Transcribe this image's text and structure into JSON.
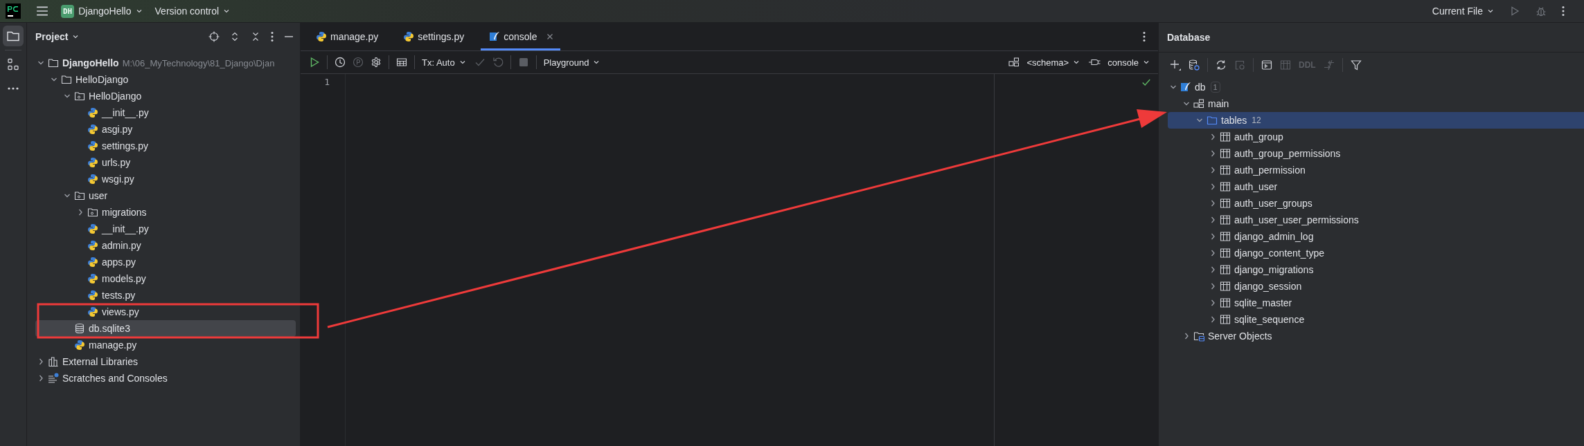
{
  "title_bar": {
    "project_badge": "DH",
    "project": "DjangoHello",
    "vcs": "Version control",
    "run_config": "Current File"
  },
  "tool_strip": [
    {
      "kind": "project",
      "selected": true
    },
    {
      "kind": "structure",
      "selected": false
    },
    {
      "kind": "more",
      "selected": false
    }
  ],
  "project_panel": {
    "title": "Project",
    "tree": [
      {
        "name": "DjangoHello",
        "path": "M:\\06_MyTechnology\\81_Django\\Djan",
        "kind": "folder",
        "expanded": true,
        "selected": false,
        "children": [
          {
            "name": "HelloDjango",
            "kind": "folder",
            "expanded": true,
            "selected": false,
            "children": [
              {
                "name": "HelloDjango",
                "kind": "package",
                "expanded": true,
                "selected": false,
                "children": [
                  {
                    "name": "__init__.py",
                    "kind": "python",
                    "selected": false
                  },
                  {
                    "name": "asgi.py",
                    "kind": "python",
                    "selected": false
                  },
                  {
                    "name": "settings.py",
                    "kind": "python",
                    "selected": false
                  },
                  {
                    "name": "urls.py",
                    "kind": "python",
                    "selected": false
                  },
                  {
                    "name": "wsgi.py",
                    "kind": "python",
                    "selected": false
                  }
                ]
              },
              {
                "name": "user",
                "kind": "package",
                "expanded": true,
                "selected": false,
                "children": [
                  {
                    "name": "migrations",
                    "kind": "package",
                    "expanded": false,
                    "selected": false
                  },
                  {
                    "name": "__init__.py",
                    "kind": "python",
                    "selected": false
                  },
                  {
                    "name": "admin.py",
                    "kind": "python",
                    "selected": false
                  },
                  {
                    "name": "apps.py",
                    "kind": "python",
                    "selected": false
                  },
                  {
                    "name": "models.py",
                    "kind": "python",
                    "selected": false
                  },
                  {
                    "name": "tests.py",
                    "kind": "python",
                    "selected": false
                  },
                  {
                    "name": "views.py",
                    "kind": "python",
                    "selected": false
                  }
                ]
              },
              {
                "name": "db.sqlite3",
                "kind": "sqlite",
                "selected": true
              },
              {
                "name": "manage.py",
                "kind": "python",
                "selected": false
              }
            ]
          }
        ]
      },
      {
        "name": "External Libraries",
        "kind": "library",
        "expanded": false,
        "selected": false
      },
      {
        "name": "Scratches and Consoles",
        "kind": "scratches",
        "expanded": false,
        "selected": false
      }
    ]
  },
  "editor": {
    "tabs": [
      {
        "label": "manage.py",
        "kind": "python",
        "selected": false
      },
      {
        "label": "settings.py",
        "kind": "python",
        "selected": false
      },
      {
        "label": "console",
        "kind": "console",
        "selected": true
      }
    ],
    "toolbar": [
      {
        "kind": "run",
        "disabled": false
      },
      {
        "kind": "separator"
      },
      {
        "kind": "history",
        "disabled": false
      },
      {
        "kind": "pin",
        "disabled": true
      },
      {
        "kind": "settings",
        "disabled": false
      },
      {
        "kind": "separator"
      },
      {
        "kind": "grid",
        "disabled": false
      },
      {
        "kind": "separator"
      },
      {
        "kind": "dropdown",
        "label": "Tx: Auto",
        "disabled": false
      },
      {
        "kind": "commit",
        "disabled": true
      },
      {
        "kind": "rollback",
        "disabled": true
      },
      {
        "kind": "separator"
      },
      {
        "kind": "stop",
        "disabled": true
      },
      {
        "kind": "separator"
      },
      {
        "kind": "dropdown",
        "label": "Playground",
        "disabled": false
      }
    ],
    "schema": "<schema>",
    "session": "console",
    "line_numbers": [
      "1"
    ]
  },
  "database_panel": {
    "title": "Database",
    "toolbar": [
      {
        "kind": "add",
        "disabled": false
      },
      {
        "kind": "datasource",
        "disabled": false
      },
      {
        "kind": "separator"
      },
      {
        "kind": "refresh",
        "disabled": false
      },
      {
        "kind": "jump",
        "disabled": true
      },
      {
        "kind": "separator"
      },
      {
        "kind": "console",
        "disabled": false
      },
      {
        "kind": "grid",
        "disabled": true
      },
      {
        "kind": "text",
        "label": "DDL",
        "disabled": true
      },
      {
        "kind": "compare",
        "disabled": true
      },
      {
        "kind": "separator"
      },
      {
        "kind": "filter",
        "disabled": false
      }
    ],
    "tree": [
      {
        "name": "db",
        "badge": "1",
        "kind": "database",
        "expanded": true,
        "selected": false,
        "children": [
          {
            "name": "main",
            "kind": "schema",
            "expanded": true,
            "selected": false,
            "children": [
              {
                "name": "tables",
                "count": "12",
                "kind": "folder",
                "expanded": true,
                "selected": true,
                "children": [
                  {
                    "name": "auth_group",
                    "kind": "table",
                    "expanded": false,
                    "selected": false
                  },
                  {
                    "name": "auth_group_permissions",
                    "kind": "table",
                    "expanded": false,
                    "selected": false
                  },
                  {
                    "name": "auth_permission",
                    "kind": "table",
                    "expanded": false,
                    "selected": false
                  },
                  {
                    "name": "auth_user",
                    "kind": "table",
                    "expanded": false,
                    "selected": false
                  },
                  {
                    "name": "auth_user_groups",
                    "kind": "table",
                    "expanded": false,
                    "selected": false
                  },
                  {
                    "name": "auth_user_user_permissions",
                    "kind": "table",
                    "expanded": false,
                    "selected": false
                  },
                  {
                    "name": "django_admin_log",
                    "kind": "table",
                    "expanded": false,
                    "selected": false
                  },
                  {
                    "name": "django_content_type",
                    "kind": "table",
                    "expanded": false,
                    "selected": false
                  },
                  {
                    "name": "django_migrations",
                    "kind": "table",
                    "expanded": false,
                    "selected": false
                  },
                  {
                    "name": "django_session",
                    "kind": "table",
                    "expanded": false,
                    "selected": false
                  },
                  {
                    "name": "sqlite_master",
                    "kind": "table",
                    "expanded": false,
                    "selected": false
                  },
                  {
                    "name": "sqlite_sequence",
                    "kind": "table",
                    "expanded": false,
                    "selected": false
                  }
                ]
              }
            ]
          },
          {
            "name": "Server Objects",
            "kind": "server",
            "expanded": false,
            "selected": false
          }
        ]
      }
    ]
  }
}
